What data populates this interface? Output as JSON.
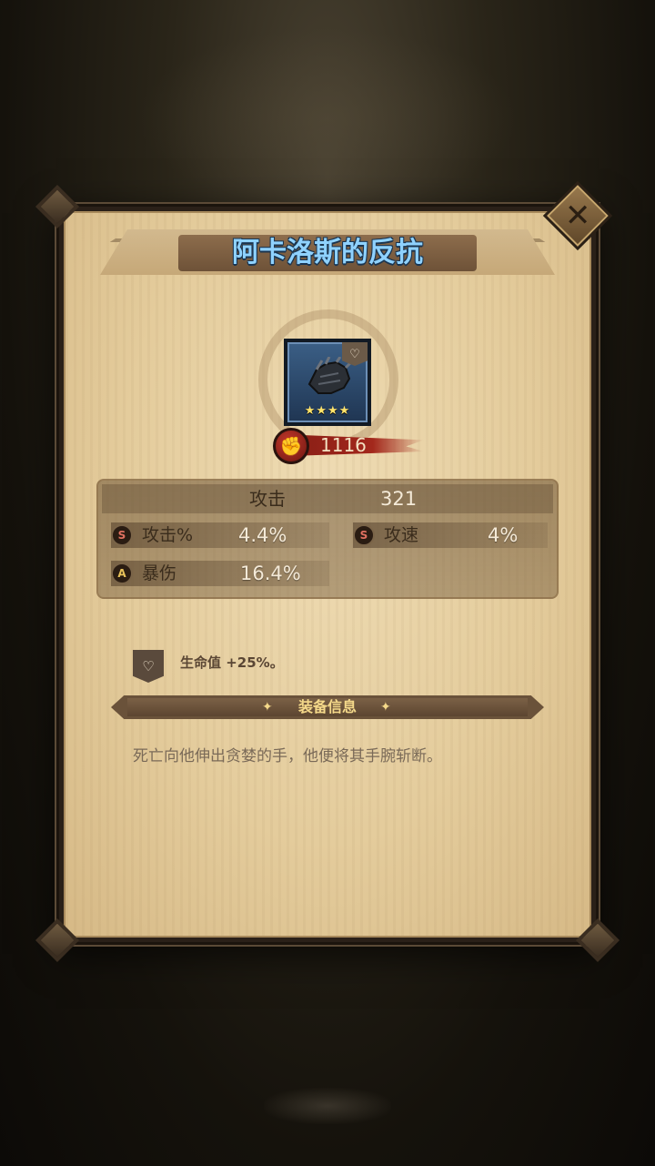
{
  "item": {
    "name": "阿卡洛斯的反抗",
    "stars": "★★★★",
    "power": "1116",
    "type_icon": "heart-shield-icon"
  },
  "stats": {
    "main": {
      "label": "攻击",
      "value": "321"
    },
    "sub": [
      {
        "grade": "S",
        "label": "攻击%",
        "value": "4.4%"
      },
      {
        "grade": "S",
        "label": "攻速",
        "value": "4%"
      },
      {
        "grade": "A",
        "label": "暴伤",
        "value": "16.4%"
      }
    ]
  },
  "bonus": {
    "icon": "heart-shield-icon",
    "text": "生命值 +25%。"
  },
  "section": {
    "title": "装备信息"
  },
  "description": "死亡向他伸出贪婪的手，他便将其手腕斩断。",
  "colors": {
    "title_text": "#8fd2ff",
    "power_bar": "#a3281c",
    "section_text": "#f5d98a",
    "parchment": "#e4cc9c"
  }
}
